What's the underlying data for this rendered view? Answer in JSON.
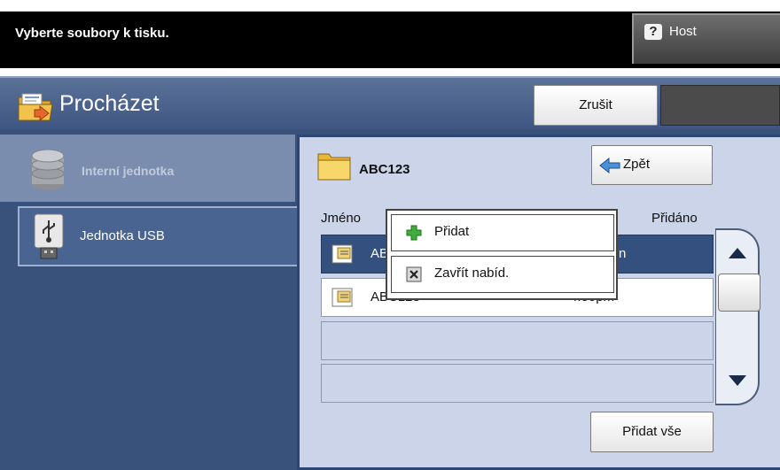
{
  "header": {
    "instruction": "Vyberte soubory k tisku.",
    "host_label": "Host",
    "host_icon": "question-icon"
  },
  "panel": {
    "title": "Procházet",
    "title_icon": "folder-browse-icon",
    "cancel_label": "Zrušit"
  },
  "nav": {
    "items": [
      {
        "label": "Interní jednotka",
        "icon": "hard-drive-icon",
        "enabled": false
      },
      {
        "label": "Jednotka USB",
        "icon": "usb-drive-icon",
        "selected": true
      }
    ]
  },
  "browser": {
    "folder_name": "ABC123",
    "back_label": "Zpět",
    "columns": {
      "name": "Jméno",
      "added": "Přidáno"
    },
    "rows": [
      {
        "name": "AB",
        "time": "n",
        "selected": true
      },
      {
        "name": "ABC123",
        "time": "4:00pm",
        "selected": false
      }
    ],
    "add_all_label": "Přidat vše"
  },
  "popup": {
    "items": [
      {
        "label": "Přidat",
        "icon": "plus-icon"
      },
      {
        "label": "Zavřít nabíd.",
        "icon": "close-icon"
      }
    ]
  },
  "colors": {
    "panel_bg": "#39527c",
    "browser_bg": "#cbd4e8",
    "selected_row": "#34507f"
  }
}
